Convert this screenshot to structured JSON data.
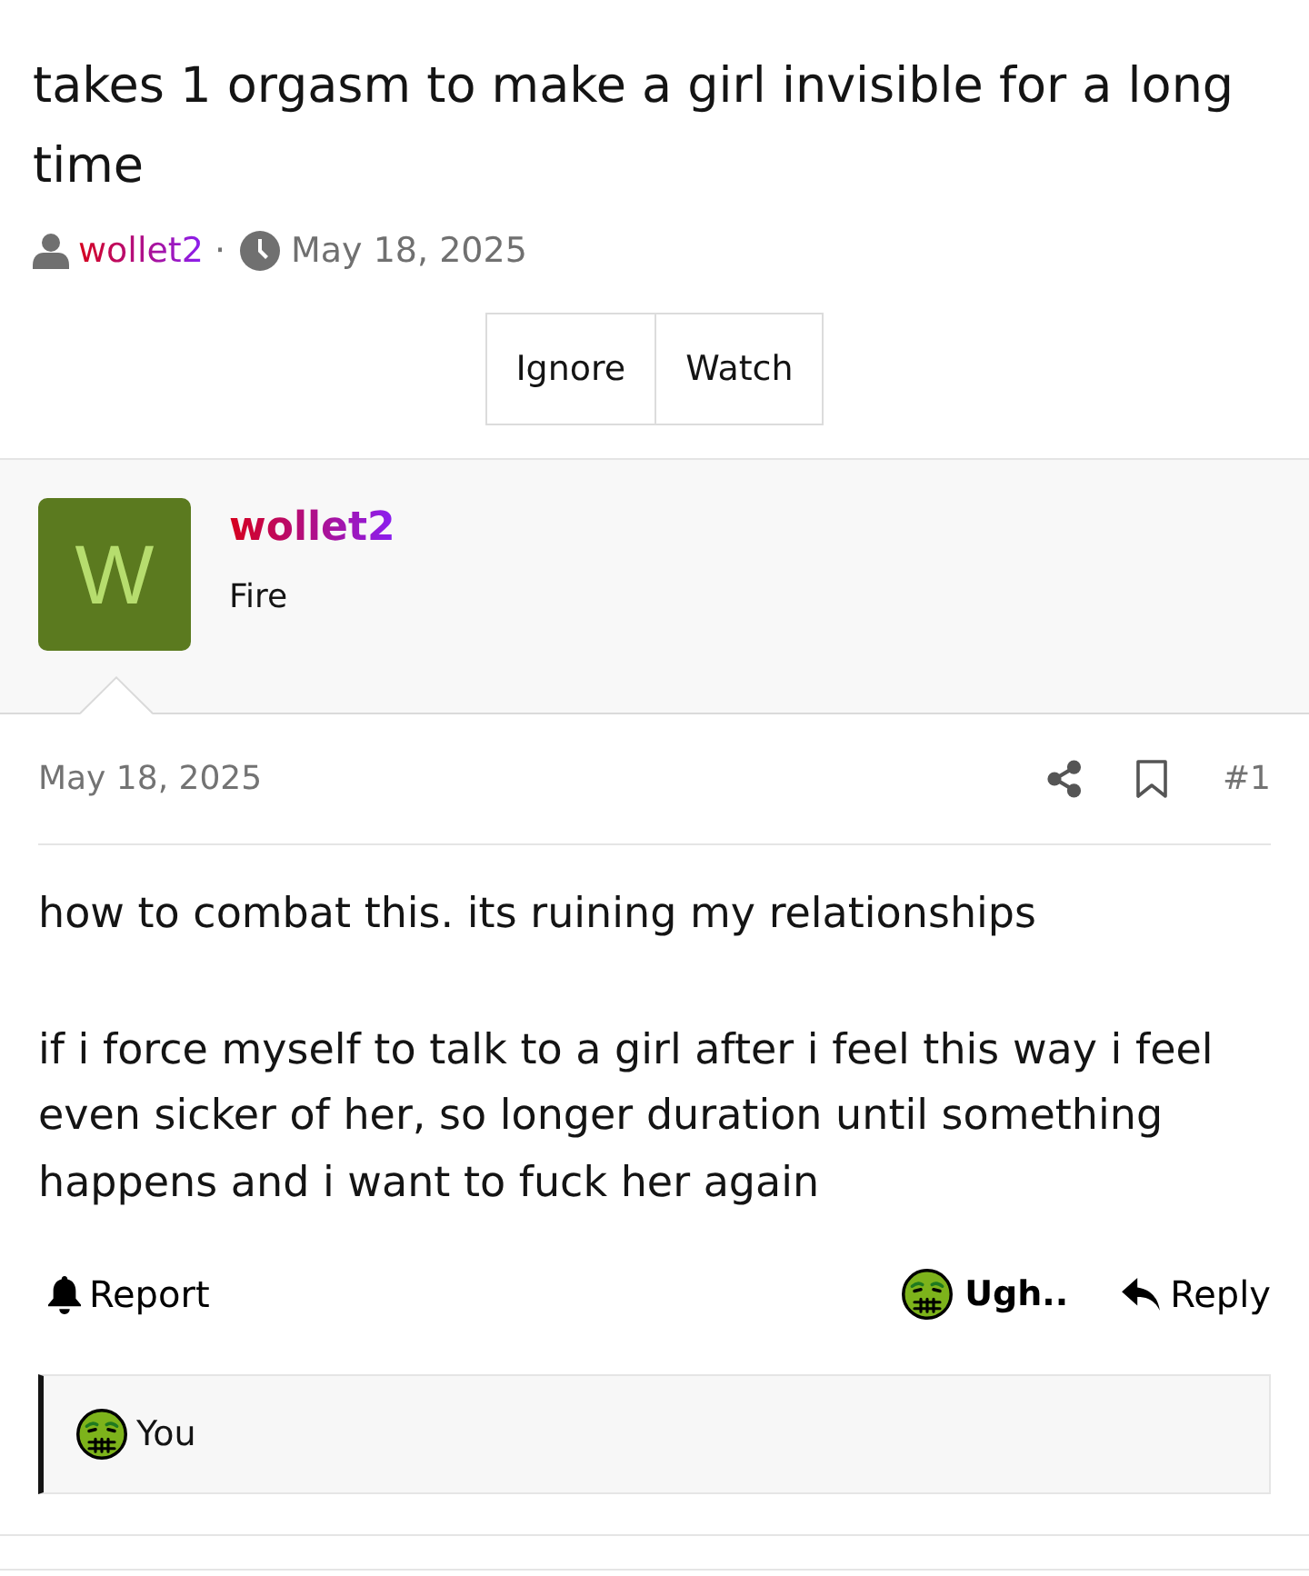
{
  "thread": {
    "title": "takes 1 orgasm to make a girl invisible for a long time",
    "author": "wollet2",
    "separator": "·",
    "date": "May 18, 2025"
  },
  "thread_buttons": [
    {
      "label": "Ignore"
    },
    {
      "label": "Watch"
    }
  ],
  "post": {
    "user": {
      "avatar_letter": "W",
      "name": "wollet2",
      "title": "Fire"
    },
    "date": "May 18, 2025",
    "number": "#1",
    "paragraphs": [
      "how to combat this. its ruining my relationships",
      "if i force myself to talk to a girl after i feel this way i feel even sicker of her, so longer duration until something happens and i want to fuck her again"
    ],
    "actions": {
      "report": "Report",
      "reaction": "Ugh..",
      "reply": "Reply"
    },
    "reactions_summary": {
      "users": "You"
    }
  }
}
